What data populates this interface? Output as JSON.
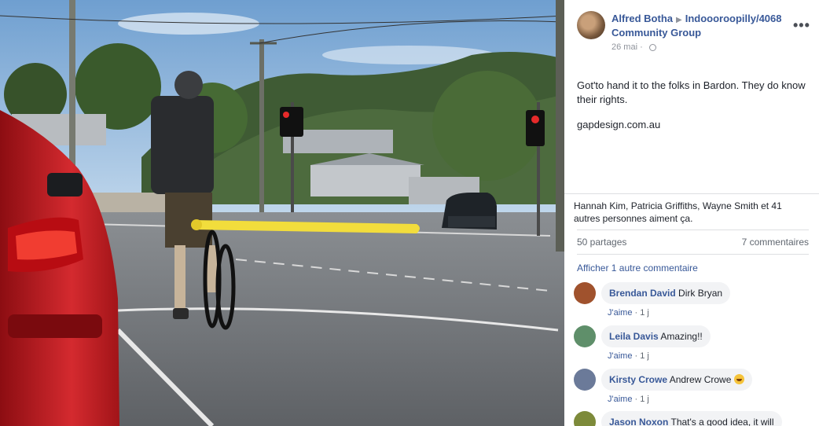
{
  "post": {
    "author": "Alfred Botha",
    "group": "Indoooroopilly/4068 Community Group",
    "date": "26 mai",
    "privacy_icon": "globe-icon",
    "menu_icon": "more-icon",
    "text": "Got'to hand it to the folks in Bardon. They do know their rights.",
    "link": "gapdesign.com.au"
  },
  "reactions": {
    "summary": "Hannah Kim, Patricia Griffiths, Wayne Smith et 41 autres personnes aiment ça."
  },
  "stats": {
    "shares": "50 partages",
    "comments": "7 commentaires"
  },
  "view_more": "Afficher 1 autre commentaire",
  "comments": [
    {
      "name": "Brendan David",
      "text": "Dirk Bryan",
      "like": "J'aime",
      "sep": "·",
      "time": "1 j",
      "avatar_color": "#a0522d"
    },
    {
      "name": "Leila Davis",
      "text": "Amazing!!",
      "like": "J'aime",
      "sep": "·",
      "time": "1 j",
      "avatar_color": "#5f8f6a"
    },
    {
      "name": "Kirsty Crowe",
      "text": "Andrew Crowe",
      "like": "J'aime",
      "sep": "·",
      "time": "1 j",
      "avatar_color": "#6b7a99",
      "emoji": "laughing-emoji-icon"
    },
    {
      "name": "Jason Noxon",
      "text": "That's a good idea, it will",
      "avatar_color": "#7d8a3a"
    }
  ],
  "colors": {
    "link_blue": "#385898",
    "meta_grey": "#90949c",
    "bubble_bg": "#f2f3f5",
    "noodle_yellow": "#f2dd3c"
  }
}
